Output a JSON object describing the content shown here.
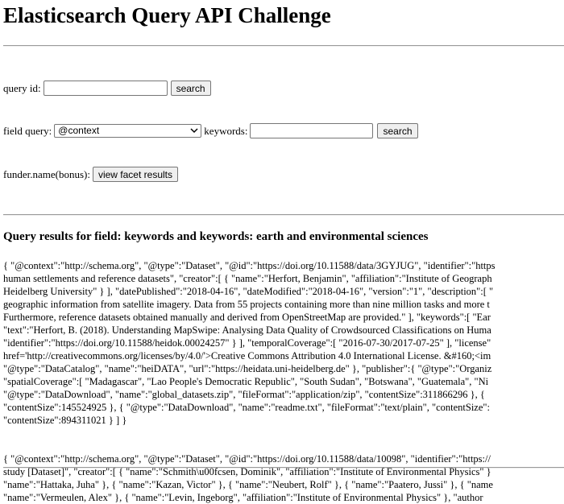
{
  "page": {
    "title": "Elasticsearch Query API Challenge"
  },
  "query_id": {
    "label": "query id:",
    "value": "",
    "button": "search"
  },
  "field_query": {
    "label": "field query:",
    "selected": "@context",
    "keywords_label": "keywords:",
    "keywords_value": "",
    "button": "search"
  },
  "funder": {
    "label": "funder.name(bonus):",
    "button": "view facet results"
  },
  "results": {
    "heading": "Query results for field: keywords and keywords: earth and environmental sciences",
    "items": [
      {
        "lines": [
          "{ \"@context\":\"http://schema.org\", \"@type\":\"Dataset\", \"@id\":\"https://doi.org/10.11588/data/3GYJUG\", \"identifier\":\"https",
          "human settlements and reference datasets\", \"creator\":[ { \"name\":\"Herfort, Benjamin\", \"affiliation\":\"Institute of Geograph",
          "Heidelberg University\" } ], \"datePublished\":\"2018-04-16\", \"dateModified\":\"2018-04-16\", \"version\":\"1\", \"description\":[ \"",
          "geographic information from satellite imagery. Data from 55 projects containing more than nine million tasks and more t",
          "Furthermore, reference datasets obtained manually and derived from OpenStreetMap are provided.\" ], \"keywords\":[ \"Ear",
          "\"text\":\"Herfort, B. (2018). Understanding MapSwipe: Analysing Data Quality of Crowdsourced Classifications on Huma",
          "\"identifier\":\"https://doi.org/10.11588/heidok.00024257\" } ], \"temporalCoverage\":[ \"2016-07-30/2017-07-25\" ], \"license\"",
          "href='http://creativecommons.org/licenses/by/4.0/'>Creative Commons Attribution 4.0 International License. &#160;<im",
          "\"@type\":\"DataCatalog\", \"name\":\"heiDATA\", \"url\":\"https://heidata.uni-heidelberg.de\" }, \"publisher\":{ \"@type\":\"Organiz",
          "\"spatialCoverage\":[ \"Madagascar\", \"Lao People's Democratic Republic\", \"South Sudan\", \"Botswana\", \"Guatemala\", \"Ni",
          "\"@type\":\"DataDownload\", \"name\":\"global_datasets.zip\", \"fileFormat\":\"application/zip\", \"contentSize\":311866296 }, {",
          "\"contentSize\":145524925 }, { \"@type\":\"DataDownload\", \"name\":\"readme.txt\", \"fileFormat\":\"text/plain\", \"contentSize\":",
          "\"contentSize\":894311021 } ] }"
        ]
      },
      {
        "lines": [
          "{ \"@context\":\"http://schema.org\", \"@type\":\"Dataset\", \"@id\":\"https://doi.org/10.11588/data/10098\", \"identifier\":\"https://",
          "study [Dataset]\", \"creator\":[ { \"name\":\"Schmith\\u00fcsen, Dominik\", \"affiliation\":\"Institute of Environmental Physics\" }",
          "\"name\":\"Hattaka, Juha\" }, { \"name\":\"Kazan, Victor\" }, { \"name\":\"Neubert, Rolf\" }, { \"name\":\"Paatero, Jussi\" }, { \"name",
          "\"name\":\"Vermeulen, Alex\" }, { \"name\":\"Levin, Ingeborg\", \"affiliation\":\"Institute of Environmental Physics\" }, \"author"
        ]
      }
    ]
  }
}
